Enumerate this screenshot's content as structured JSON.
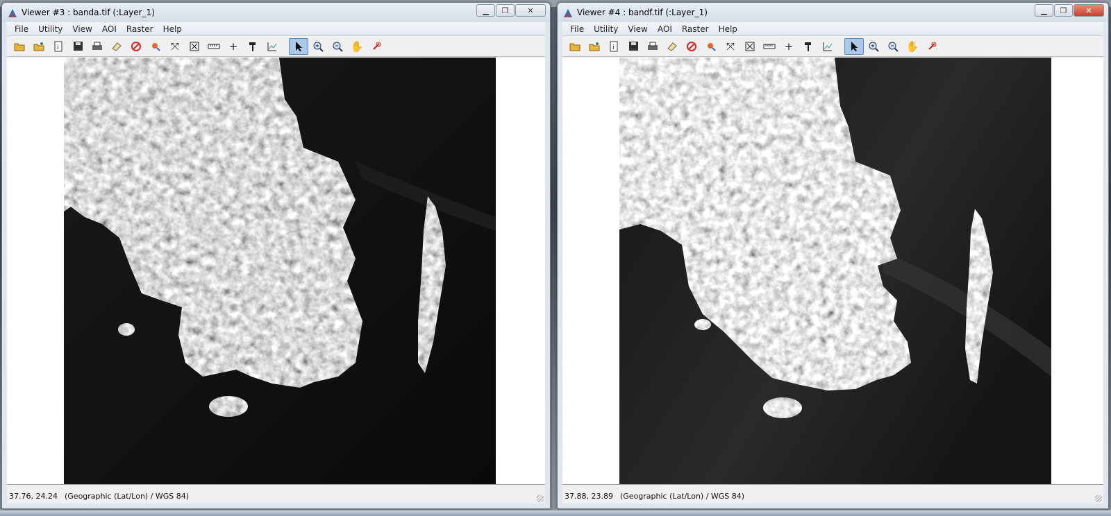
{
  "viewers": [
    {
      "title": "Viewer #3 : banda.tif (:Layer_1)",
      "menu": [
        "File",
        "Utility",
        "View",
        "AOI",
        "Raster",
        "Help"
      ],
      "status": {
        "coords": "37.76, 24.24",
        "projection": "(Geographic (Lat/Lon) / WGS 84)"
      }
    },
    {
      "title": "Viewer #4 : bandf.tif (:Layer_1)",
      "menu": [
        "File",
        "Utility",
        "View",
        "AOI",
        "Raster",
        "Help"
      ],
      "status": {
        "coords": "37.88, 23.89",
        "projection": "(Geographic (Lat/Lon) / WGS 84)"
      }
    }
  ],
  "toolbar_icons": [
    "open-icon",
    "open-layer-icon",
    "layer-info-icon",
    "save-icon",
    "print-icon",
    "erase-icon",
    "clear-icon",
    "inquire-icon",
    "zoom-fit-icon",
    "scale-to-window-icon",
    "measure-icon",
    "crosshair-icon",
    "hammer-icon",
    "profile-icon",
    "select-arrow-icon",
    "zoom-in-icon",
    "zoom-out-icon",
    "pan-hand-icon",
    "inquire-box-icon"
  ]
}
